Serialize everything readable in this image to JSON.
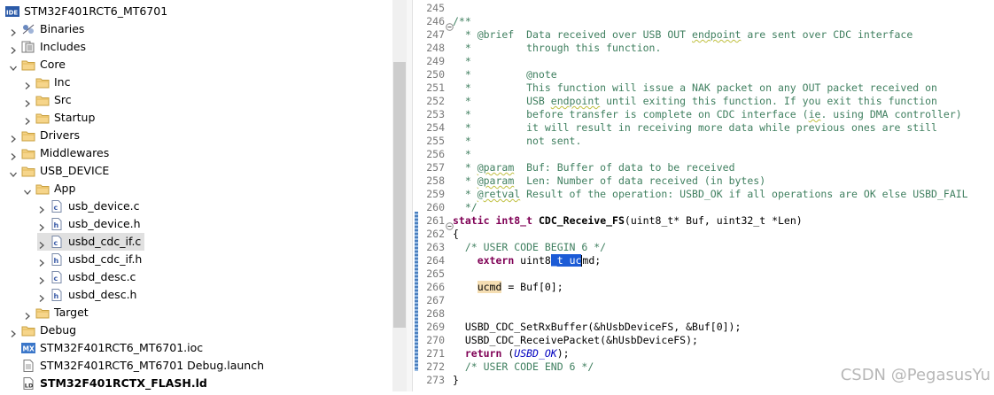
{
  "explorer": {
    "items": [
      {
        "label": "STM32F401RCT6_MT6701",
        "icon": "project-ide-icon",
        "level": 0,
        "chevron": "none",
        "bold": false,
        "selected": false
      },
      {
        "label": "Binaries",
        "icon": "binaries-icon",
        "level": 1,
        "chevron": "right",
        "bold": false,
        "selected": false
      },
      {
        "label": "Includes",
        "icon": "includes-icon",
        "level": 1,
        "chevron": "right",
        "bold": false,
        "selected": false
      },
      {
        "label": "Core",
        "icon": "folder-icon",
        "level": 1,
        "chevron": "down",
        "bold": false,
        "selected": false
      },
      {
        "label": "Inc",
        "icon": "folder-icon",
        "level": 2,
        "chevron": "right",
        "bold": false,
        "selected": false
      },
      {
        "label": "Src",
        "icon": "folder-icon",
        "level": 2,
        "chevron": "right",
        "bold": false,
        "selected": false
      },
      {
        "label": "Startup",
        "icon": "folder-icon",
        "level": 2,
        "chevron": "right",
        "bold": false,
        "selected": false
      },
      {
        "label": "Drivers",
        "icon": "folder-icon",
        "level": 1,
        "chevron": "right",
        "bold": false,
        "selected": false
      },
      {
        "label": "Middlewares",
        "icon": "folder-icon",
        "level": 1,
        "chevron": "right",
        "bold": false,
        "selected": false
      },
      {
        "label": "USB_DEVICE",
        "icon": "folder-icon",
        "level": 1,
        "chevron": "down",
        "bold": false,
        "selected": false
      },
      {
        "label": "App",
        "icon": "folder-icon",
        "level": 2,
        "chevron": "down",
        "bold": false,
        "selected": false
      },
      {
        "label": "usb_device.c",
        "icon": "c-file-icon",
        "level": 3,
        "chevron": "right",
        "bold": false,
        "selected": false
      },
      {
        "label": "usb_device.h",
        "icon": "h-file-icon",
        "level": 3,
        "chevron": "right",
        "bold": false,
        "selected": false
      },
      {
        "label": "usbd_cdc_if.c",
        "icon": "c-file-icon",
        "level": 3,
        "chevron": "right",
        "bold": false,
        "selected": true
      },
      {
        "label": "usbd_cdc_if.h",
        "icon": "h-file-icon",
        "level": 3,
        "chevron": "right",
        "bold": false,
        "selected": false
      },
      {
        "label": "usbd_desc.c",
        "icon": "c-file-icon",
        "level": 3,
        "chevron": "right",
        "bold": false,
        "selected": false
      },
      {
        "label": "usbd_desc.h",
        "icon": "h-file-icon",
        "level": 3,
        "chevron": "right",
        "bold": false,
        "selected": false
      },
      {
        "label": "Target",
        "icon": "folder-icon",
        "level": 2,
        "chevron": "right",
        "bold": false,
        "selected": false
      },
      {
        "label": "Debug",
        "icon": "folder-icon",
        "level": 1,
        "chevron": "right",
        "bold": false,
        "selected": false
      },
      {
        "label": "STM32F401RCT6_MT6701.ioc",
        "icon": "mx-icon",
        "level": 1,
        "chevron": "none",
        "bold": false,
        "selected": false
      },
      {
        "label": "STM32F401RCT6_MT6701 Debug.launch",
        "icon": "launch-file-icon",
        "level": 1,
        "chevron": "none",
        "bold": false,
        "selected": false
      },
      {
        "label": "STM32F401RCTX_FLASH.ld",
        "icon": "ld-file-icon",
        "level": 1,
        "chevron": "none",
        "bold": true,
        "selected": false
      }
    ]
  },
  "editor": {
    "lines": [
      {
        "n": "245",
        "fold": "",
        "tokens": []
      },
      {
        "n": "246",
        "fold": "minus",
        "tokens": [
          {
            "t": "/**",
            "c": "cm"
          }
        ]
      },
      {
        "n": "247",
        "fold": "",
        "tokens": [
          {
            "t": "  * @brief  Data received over USB OUT ",
            "c": "cm"
          },
          {
            "t": "endpoint",
            "c": "cm sq"
          },
          {
            "t": " are sent over CDC interface",
            "c": "cm"
          }
        ]
      },
      {
        "n": "248",
        "fold": "",
        "tokens": [
          {
            "t": "  *         through this function.",
            "c": "cm"
          }
        ]
      },
      {
        "n": "249",
        "fold": "",
        "tokens": [
          {
            "t": "  *",
            "c": "cm"
          }
        ]
      },
      {
        "n": "250",
        "fold": "",
        "tokens": [
          {
            "t": "  *         @note",
            "c": "cm"
          }
        ]
      },
      {
        "n": "251",
        "fold": "",
        "tokens": [
          {
            "t": "  *         This function will issue a NAK packet on any OUT packet received on",
            "c": "cm"
          }
        ]
      },
      {
        "n": "252",
        "fold": "",
        "tokens": [
          {
            "t": "  *         USB ",
            "c": "cm"
          },
          {
            "t": "endpoint",
            "c": "cm sq"
          },
          {
            "t": " until exiting this function. If you exit this function",
            "c": "cm"
          }
        ]
      },
      {
        "n": "253",
        "fold": "",
        "tokens": [
          {
            "t": "  *         before transfer is complete on CDC interface (",
            "c": "cm"
          },
          {
            "t": "ie",
            "c": "cm sq"
          },
          {
            "t": ". using DMA controller)",
            "c": "cm"
          }
        ]
      },
      {
        "n": "254",
        "fold": "",
        "tokens": [
          {
            "t": "  *         it will result in receiving more data while previous ones are still",
            "c": "cm"
          }
        ]
      },
      {
        "n": "255",
        "fold": "",
        "tokens": [
          {
            "t": "  *         not sent.",
            "c": "cm"
          }
        ]
      },
      {
        "n": "256",
        "fold": "",
        "tokens": [
          {
            "t": "  *",
            "c": "cm"
          }
        ]
      },
      {
        "n": "257",
        "fold": "",
        "tokens": [
          {
            "t": "  * ",
            "c": "cm"
          },
          {
            "t": "@param",
            "c": "cm sq"
          },
          {
            "t": "  Buf: Buffer of data to be received",
            "c": "cm"
          }
        ]
      },
      {
        "n": "258",
        "fold": "",
        "tokens": [
          {
            "t": "  * ",
            "c": "cm"
          },
          {
            "t": "@param",
            "c": "cm sq"
          },
          {
            "t": "  Len: Number of data received (in bytes)",
            "c": "cm"
          }
        ]
      },
      {
        "n": "259",
        "fold": "",
        "tokens": [
          {
            "t": "  * ",
            "c": "cm"
          },
          {
            "t": "@retval",
            "c": "cm sq"
          },
          {
            "t": " Result of the operation: USBD_OK if all operations are OK else USBD_FAIL",
            "c": "cm"
          }
        ]
      },
      {
        "n": "260",
        "fold": "",
        "tokens": [
          {
            "t": "  */",
            "c": "cm"
          }
        ]
      },
      {
        "n": "261",
        "fold": "minus",
        "tokens": [
          {
            "t": "static",
            "c": "kw"
          },
          {
            "t": " ",
            "c": ""
          },
          {
            "t": "int8_t",
            "c": "kw"
          },
          {
            "t": " ",
            "c": ""
          },
          {
            "t": "CDC_Receive_FS",
            "c": "fn"
          },
          {
            "t": "(uint8_t* Buf, uint32_t *Len)",
            "c": ""
          }
        ]
      },
      {
        "n": "262",
        "fold": "",
        "tokens": [
          {
            "t": "{",
            "c": ""
          }
        ]
      },
      {
        "n": "263",
        "fold": "",
        "tokens": [
          {
            "t": "  /* USER CODE BEGIN 6 */",
            "c": "cm"
          }
        ]
      },
      {
        "n": "264",
        "fold": "",
        "tokens": [
          {
            "t": "    ",
            "c": ""
          },
          {
            "t": "extern",
            "c": "kw"
          },
          {
            "t": " uint8",
            "c": ""
          },
          {
            "t": "_t uc",
            "c": "selx"
          },
          {
            "t": "|",
            "c": "caret"
          },
          {
            "t": "md;",
            "c": ""
          }
        ]
      },
      {
        "n": "265",
        "fold": "",
        "tokens": []
      },
      {
        "n": "266",
        "fold": "",
        "tokens": [
          {
            "t": "    ",
            "c": ""
          },
          {
            "t": "ucmd",
            "c": "hl"
          },
          {
            "t": " = Buf[0];",
            "c": ""
          }
        ]
      },
      {
        "n": "267",
        "fold": "",
        "tokens": []
      },
      {
        "n": "268",
        "fold": "",
        "tokens": []
      },
      {
        "n": "269",
        "fold": "",
        "tokens": [
          {
            "t": "  USBD_CDC_SetRxBuffer(&hUsbDeviceFS, &Buf[0]);",
            "c": ""
          }
        ]
      },
      {
        "n": "270",
        "fold": "",
        "tokens": [
          {
            "t": "  USBD_CDC_ReceivePacket(&hUsbDeviceFS);",
            "c": ""
          }
        ]
      },
      {
        "n": "271",
        "fold": "",
        "tokens": [
          {
            "t": "  ",
            "c": ""
          },
          {
            "t": "return",
            "c": "kw"
          },
          {
            "t": " (",
            "c": ""
          },
          {
            "t": "USBD_OK",
            "c": "it"
          },
          {
            "t": ");",
            "c": ""
          }
        ]
      },
      {
        "n": "272",
        "fold": "",
        "tokens": [
          {
            "t": "  /* USER CODE END 6 */",
            "c": "cm"
          }
        ]
      },
      {
        "n": "273",
        "fold": "",
        "tokens": [
          {
            "t": "}",
            "c": ""
          }
        ]
      }
    ]
  },
  "watermark": "CSDN @PegasusYu"
}
